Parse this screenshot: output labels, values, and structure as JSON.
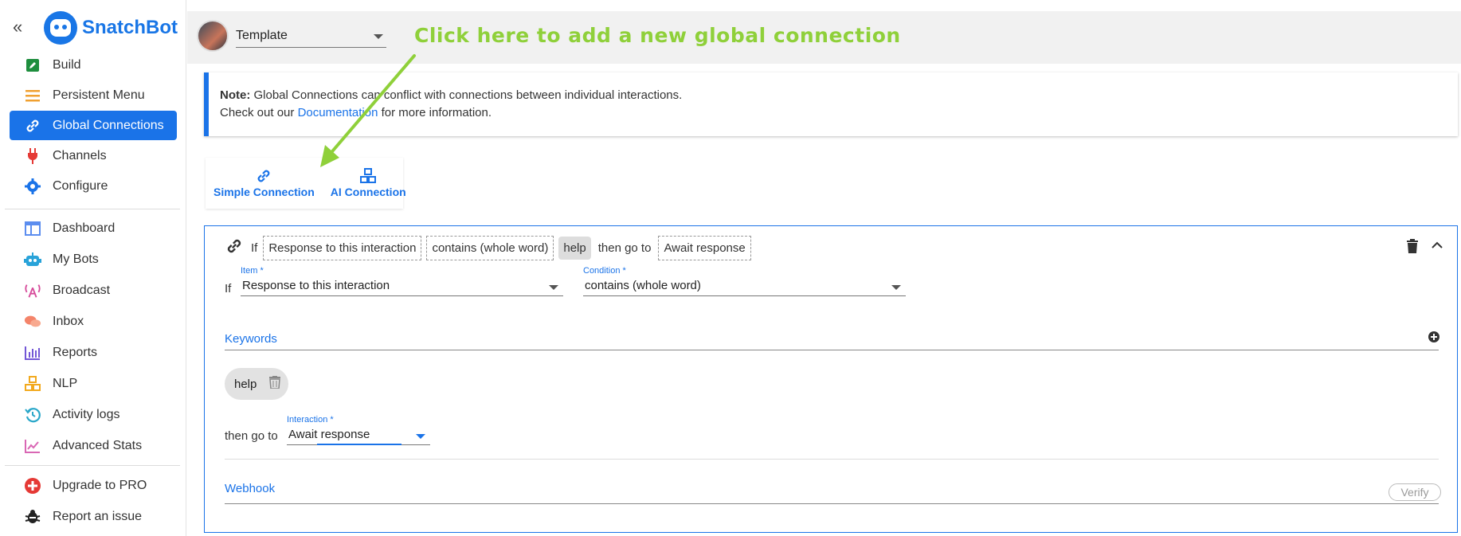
{
  "app": {
    "name": "SnatchBot",
    "collapse": "«"
  },
  "sidebar": {
    "items": [
      {
        "label": "Build",
        "icon": "pencil-square-icon"
      },
      {
        "label": "Persistent Menu",
        "icon": "menu-lines-icon"
      },
      {
        "label": "Global Connections",
        "icon": "link-icon",
        "active": true
      },
      {
        "label": "Channels",
        "icon": "plug-icon"
      },
      {
        "label": "Configure",
        "icon": "gear-icon"
      },
      {
        "label": "Dashboard",
        "icon": "dashboard-icon"
      },
      {
        "label": "My Bots",
        "icon": "robot-icon"
      },
      {
        "label": "Broadcast",
        "icon": "broadcast-icon"
      },
      {
        "label": "Inbox",
        "icon": "chat-bubbles-icon"
      },
      {
        "label": "Reports",
        "icon": "bar-chart-icon"
      },
      {
        "label": "NLP",
        "icon": "cubes-icon"
      },
      {
        "label": "Activity logs",
        "icon": "history-icon"
      },
      {
        "label": "Advanced Stats",
        "icon": "line-chart-icon"
      },
      {
        "label": "Upgrade to PRO",
        "icon": "plus-badge-icon"
      },
      {
        "label": "Report an issue",
        "icon": "bug-icon"
      }
    ]
  },
  "topbar": {
    "template_value": "Template"
  },
  "annotation": "Click here to add a new global connection",
  "note": {
    "prefix": "Note:",
    "line1": " Global Connections can conflict with connections between individual interactions.",
    "line2_before": "Check out our ",
    "link": "Documentation",
    "line2_after": " for more information."
  },
  "conn_buttons": {
    "simple": "Simple Connection",
    "ai": "AI Connection"
  },
  "connection": {
    "summary": {
      "if": "If",
      "item": "Response to this interaction",
      "condition": "contains (whole word)",
      "keyword": "help",
      "then_go_to": "then go to",
      "target": "Await response"
    },
    "if_label": "If",
    "item_field": {
      "label": "Item *",
      "value": "Response to this interaction"
    },
    "condition_field": {
      "label": "Condition *",
      "value": "contains (whole word)"
    },
    "keywords_title": "Keywords",
    "keywords": [
      "help"
    ],
    "goto_label": "then go to",
    "interaction_field": {
      "label": "Interaction *",
      "value": "Await response"
    },
    "webhook_title": "Webhook",
    "verify": "Verify"
  },
  "colors": {
    "accent": "#1a73e8",
    "annotation": "#8fd03a"
  }
}
